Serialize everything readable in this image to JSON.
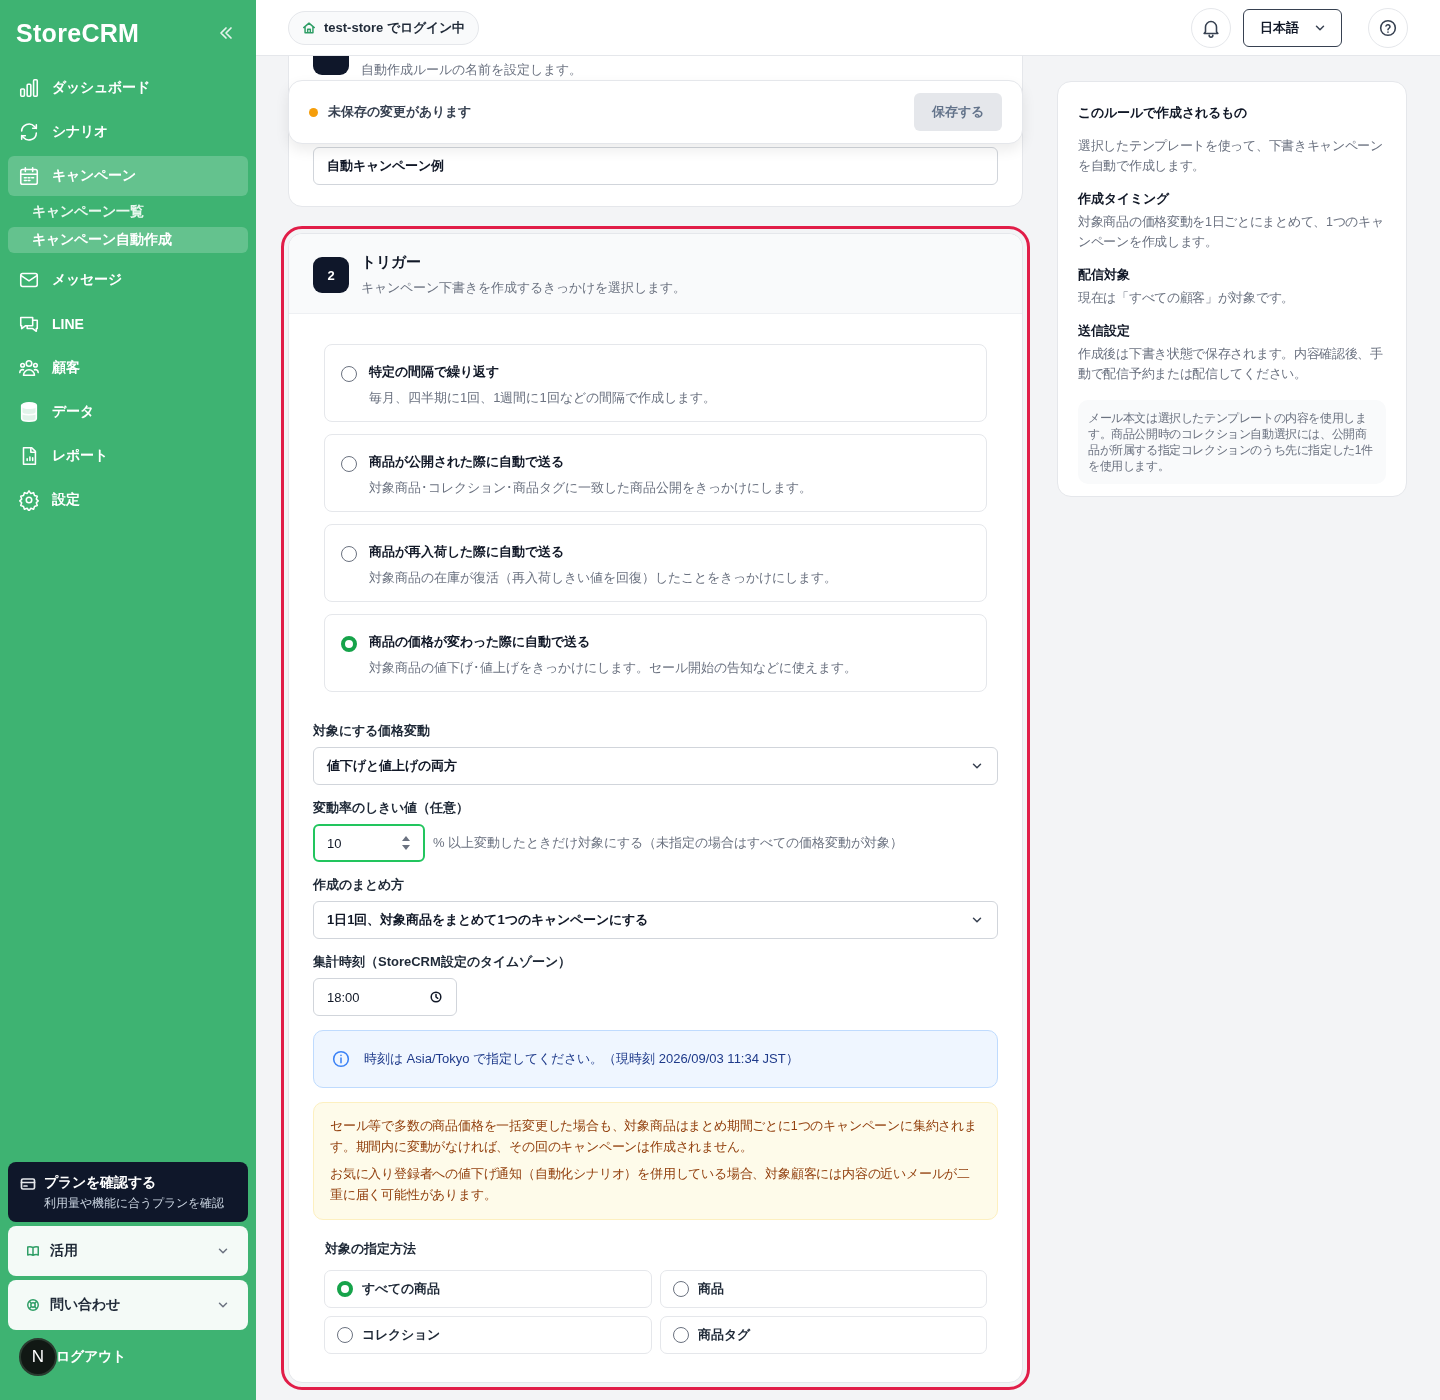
{
  "sidebar": {
    "logo": "StoreCRM",
    "items": [
      {
        "label": "ダッシュボード",
        "selected": false
      },
      {
        "label": "シナリオ",
        "selected": false
      },
      {
        "label": "キャンペーン",
        "selected": true,
        "children": [
          {
            "label": "キャンペーン一覧",
            "selected": false
          },
          {
            "label": "キャンペーン自動作成",
            "selected": true
          }
        ]
      },
      {
        "label": "メッセージ",
        "selected": false
      },
      {
        "label": "LINE",
        "selected": false
      },
      {
        "label": "顧客",
        "selected": false
      },
      {
        "label": "データ",
        "selected": false
      },
      {
        "label": "レポート",
        "selected": false
      },
      {
        "label": "設定",
        "selected": false
      }
    ],
    "plan_card": {
      "title": "プランを確認する",
      "subtitle": "利用量や機能に合うプランを確認"
    },
    "accordions": [
      {
        "label": "活用",
        "expanded": false
      },
      {
        "label": "問い合わせ",
        "expanded": false
      }
    ],
    "avatar": "N",
    "logout": "ログアウト"
  },
  "header": {
    "login_badge": "test-store でログイン中",
    "language": "日本語"
  },
  "unsaved_bar": {
    "dirty": true,
    "text": "未保存の変更があります",
    "save_button": "保存する",
    "disabled": true
  },
  "step1": {
    "description": "自動作成ルールの名前を設定します。",
    "name_value": "自動キャンペーン例"
  },
  "step2": {
    "number": "2",
    "title": "トリガー",
    "description": "キャンペーン下書きを作成するきっかけを選択します。",
    "highlighted": true,
    "trigger_options": [
      {
        "title": "特定の間隔で繰り返す",
        "description": "毎月、四半期に1回、1週間に1回などの間隔で作成します。",
        "selected": false
      },
      {
        "title": "商品が公開された際に自動で送る",
        "description": "対象商品･コレクション･商品タグに一致した商品公開をきっかけにします。",
        "selected": false
      },
      {
        "title": "商品が再入荷した際に自動で送る",
        "description": "対象商品の在庫が復活（再入荷しきい値を回復）したことをきっかけにします。",
        "selected": false
      },
      {
        "title": "商品の価格が変わった際に自動で送る",
        "description": "対象商品の値下げ･値上げをきっかけにします。セール開始の告知などに使えます。",
        "selected": true
      }
    ],
    "price_change": {
      "label": "対象にする価格変動",
      "value": "値下げと値上げの両方"
    },
    "threshold": {
      "label": "変動率のしきい値（任意）",
      "value": "10",
      "focused": true,
      "suffix": "% 以上変動したときだけ対象にする（未指定の場合はすべての価格変動が対象）"
    },
    "grouping": {
      "label": "作成のまとめ方",
      "value": "1日1回、対象商品をまとめて1つのキャンペーンにする"
    },
    "time": {
      "label": "集計時刻（StoreCRM設定のタイムゾーン）",
      "value": "18:00"
    },
    "info_note": "時刻は Asia/Tokyo で指定してください。（現時刻 2026/09/03 11:34 JST）",
    "warning": [
      "セール等で多数の商品価格を一括変更した場合も、対象商品はまとめ期間ごとに1つのキャンペーンに集約されます。期間内に変動がなければ、その回のキャンペーンは作成されません。",
      "お気に入り登録者への値下げ通知（自動化シナリオ）を併用している場合、対象顧客には内容の近いメールが二重に届く可能性があります。"
    ],
    "target": {
      "label": "対象の指定方法",
      "options": [
        {
          "label": "すべての商品",
          "selected": true
        },
        {
          "label": "商品",
          "selected": false
        },
        {
          "label": "コレクション",
          "selected": false
        },
        {
          "label": "商品タグ",
          "selected": false
        }
      ]
    }
  },
  "summary": {
    "title": "このルールで作成されるもの",
    "intro": "選択したテンプレートを使って、下書きキャンペーンを自動で作成します。",
    "sections": [
      {
        "heading": "作成タイミング",
        "text": "対象商品の価格変動を1日ごとにまとめて、1つのキャンペーンを作成します。"
      },
      {
        "heading": "配信対象",
        "text": "現在は「すべての顧客」が対象です。"
      },
      {
        "heading": "送信設定",
        "text": "作成後は下書き状態で保存されます。内容確認後、手動で配信予約または配信してください。"
      }
    ],
    "note": "メール本文は選択したテンプレートの内容を使用します。商品公開時のコレクション自動選択には、公開商品が所属する指定コレクションのうち先に指定した1件を使用します。"
  }
}
